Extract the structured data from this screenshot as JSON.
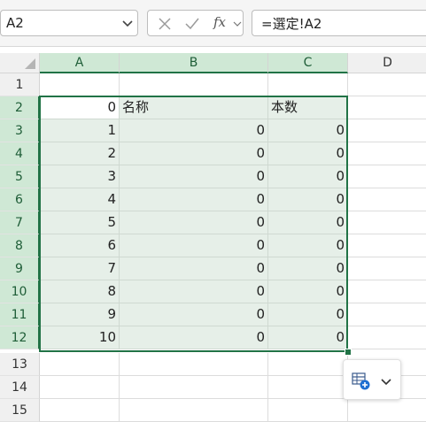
{
  "name_box": {
    "value": "A2"
  },
  "formula_bar": {
    "fx_label": "fx",
    "formula": "=選定!A2"
  },
  "columns": [
    "A",
    "B",
    "C",
    "D"
  ],
  "rows": [
    "1",
    "2",
    "3",
    "4",
    "5",
    "6",
    "7",
    "8",
    "9",
    "10",
    "11",
    "12",
    "13",
    "14",
    "15"
  ],
  "cells": {
    "A2": "0",
    "B2": "名称",
    "C2": "本数",
    "A3": "1",
    "B3": "0",
    "C3": "0",
    "A4": "2",
    "B4": "0",
    "C4": "0",
    "A5": "3",
    "B5": "0",
    "C5": "0",
    "A6": "4",
    "B6": "0",
    "C6": "0",
    "A7": "5",
    "B7": "0",
    "C7": "0",
    "A8": "6",
    "B8": "0",
    "C8": "0",
    "A9": "7",
    "B9": "0",
    "C9": "0",
    "A10": "8",
    "B10": "0",
    "C10": "0",
    "A11": "9",
    "B11": "0",
    "C11": "0",
    "A12": "10",
    "B12": "0",
    "C12": "0"
  },
  "selection": {
    "range": "A2:C12",
    "active_cell": "A2"
  },
  "colors": {
    "accent": "#217346",
    "header_selected": "#cfe8d5",
    "range_fill": "#e6efe8"
  },
  "quick_analysis": {
    "icon": "quick-analysis-icon",
    "menu_icon": "chevron-down-icon"
  }
}
